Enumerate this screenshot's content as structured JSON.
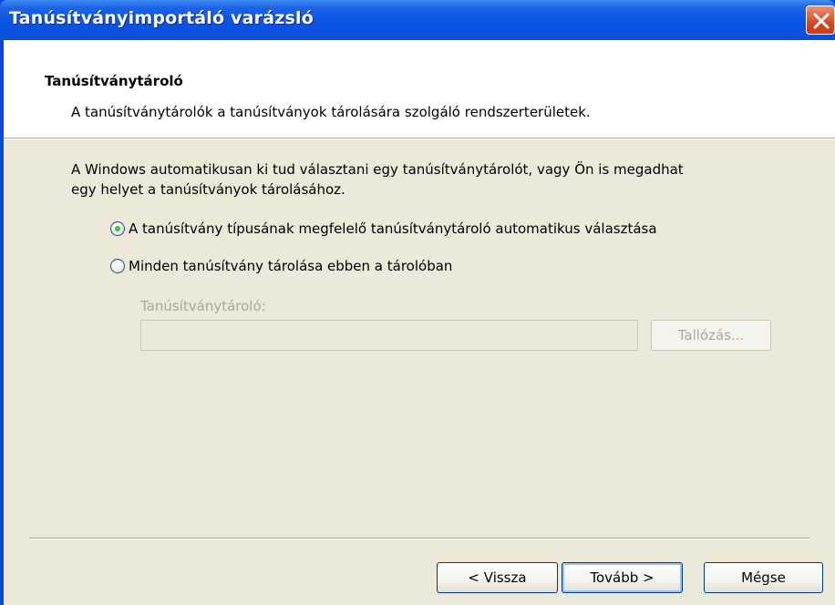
{
  "window": {
    "title": "Tanúsítványimportáló varázsló"
  },
  "header": {
    "title": "Tanúsítványtároló",
    "subtitle": "A tanúsítványtárolók a tanúsítványok tárolására szolgáló rendszerterületek."
  },
  "body": {
    "intro": "A Windows automatikusan ki tud választani egy tanúsítványtárolót, vagy Ön is megadhat egy helyet a tanúsítványok tárolásához.",
    "options": [
      {
        "label": "A tanúsítvány típusának megfelelő tanúsítványtároló automatikus választása",
        "checked": true
      },
      {
        "label": "Minden tanúsítvány tárolása ebben a tárolóban",
        "checked": false
      }
    ],
    "store_label": "Tanúsítványtároló:",
    "store_value": "",
    "browse_label": "Tallózás..."
  },
  "footer": {
    "back_label": "< Vissza",
    "next_label": "Tovább >",
    "cancel_label": "Mégse"
  },
  "colors": {
    "titlebar": "#0a54e3",
    "dialog_bg": "#ece9d8",
    "close": "#d7461f"
  }
}
